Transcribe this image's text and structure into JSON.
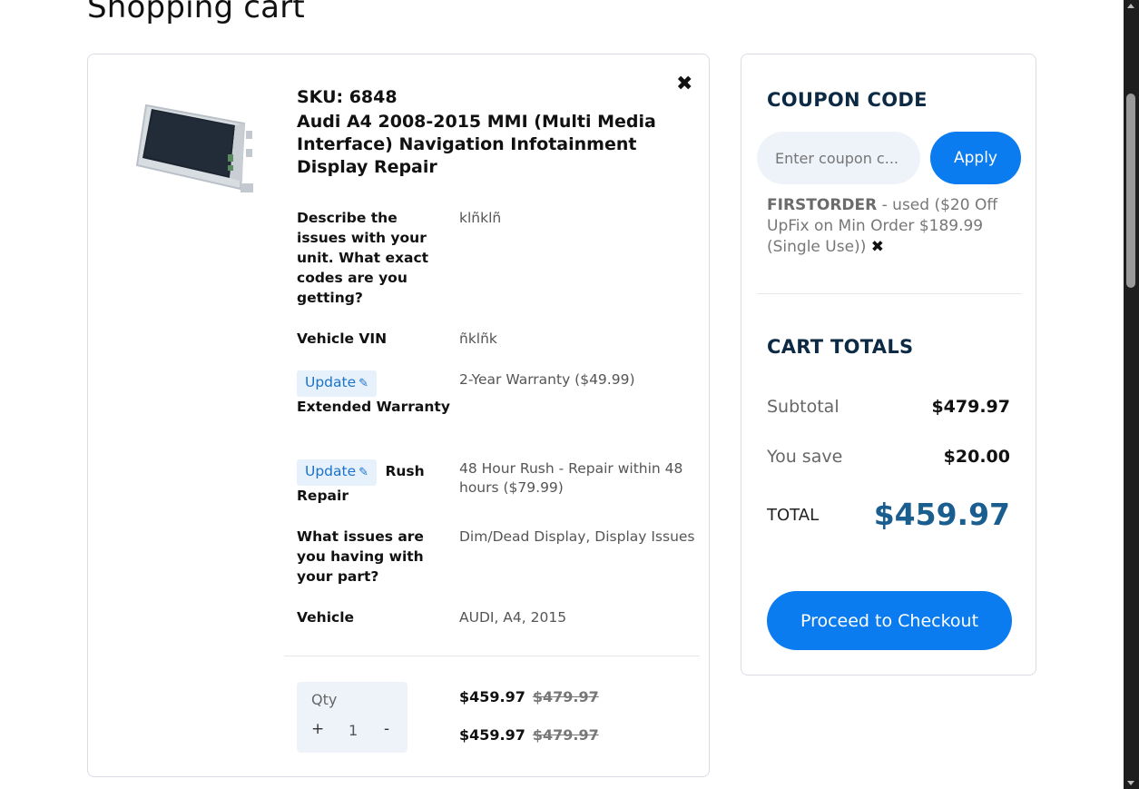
{
  "page": {
    "title": "Shopping cart"
  },
  "item": {
    "remove_glyph": "✖",
    "sku": "SKU: 6848",
    "name": "Audi A4 2008-2015 MMI (Multi Media Interface) Navigation Infotainment Display Repair",
    "options": [
      {
        "label": "Describe the issues with your unit. What exact codes are you getting?",
        "value": "klñklñ"
      },
      {
        "label": "Vehicle VIN",
        "value": "ñklñk"
      },
      {
        "update_label": "Update",
        "label": "Extended Warranty",
        "value": "2-Year Warranty ($49.99)"
      },
      {
        "update_label": "Update",
        "label": "Rush Repair",
        "value": "48 Hour Rush - Repair within 48 hours ($79.99)"
      },
      {
        "label": "What issues are you having with your part?",
        "value": "Dim/Dead Display, Display Issues"
      },
      {
        "label": "Vehicle",
        "value": "AUDI, A4, 2015"
      }
    ],
    "qty": {
      "label": "Qty",
      "plus": "+",
      "value": "1",
      "minus": "-"
    },
    "prices": [
      {
        "price": "$459.97",
        "old_price": "$479.97"
      },
      {
        "price": "$459.97",
        "old_price": "$479.97"
      }
    ]
  },
  "coupon": {
    "title": "COUPON CODE",
    "placeholder": "Enter coupon c...",
    "apply_label": "Apply",
    "applied_code": "FIRSTORDER",
    "applied_note": " - used ($20 Off UpFix on Min Order $189.99 (Single Use))",
    "remove_glyph": "✖"
  },
  "totals": {
    "title": "CART TOTALS",
    "subtotal_label": "Subtotal",
    "subtotal_value": "$479.97",
    "save_label": "You save",
    "save_value": "$20.00",
    "total_label": "TOTAL",
    "total_value": "$459.97",
    "checkout_label": "Proceed to Checkout"
  },
  "icons": {
    "pencil": "pencil-icon",
    "remove": "close-icon"
  },
  "colors": {
    "accent": "#0a7cf0",
    "heading": "#0d2a45",
    "total": "#1a5d8f",
    "update_bg": "#e6f1fb"
  }
}
